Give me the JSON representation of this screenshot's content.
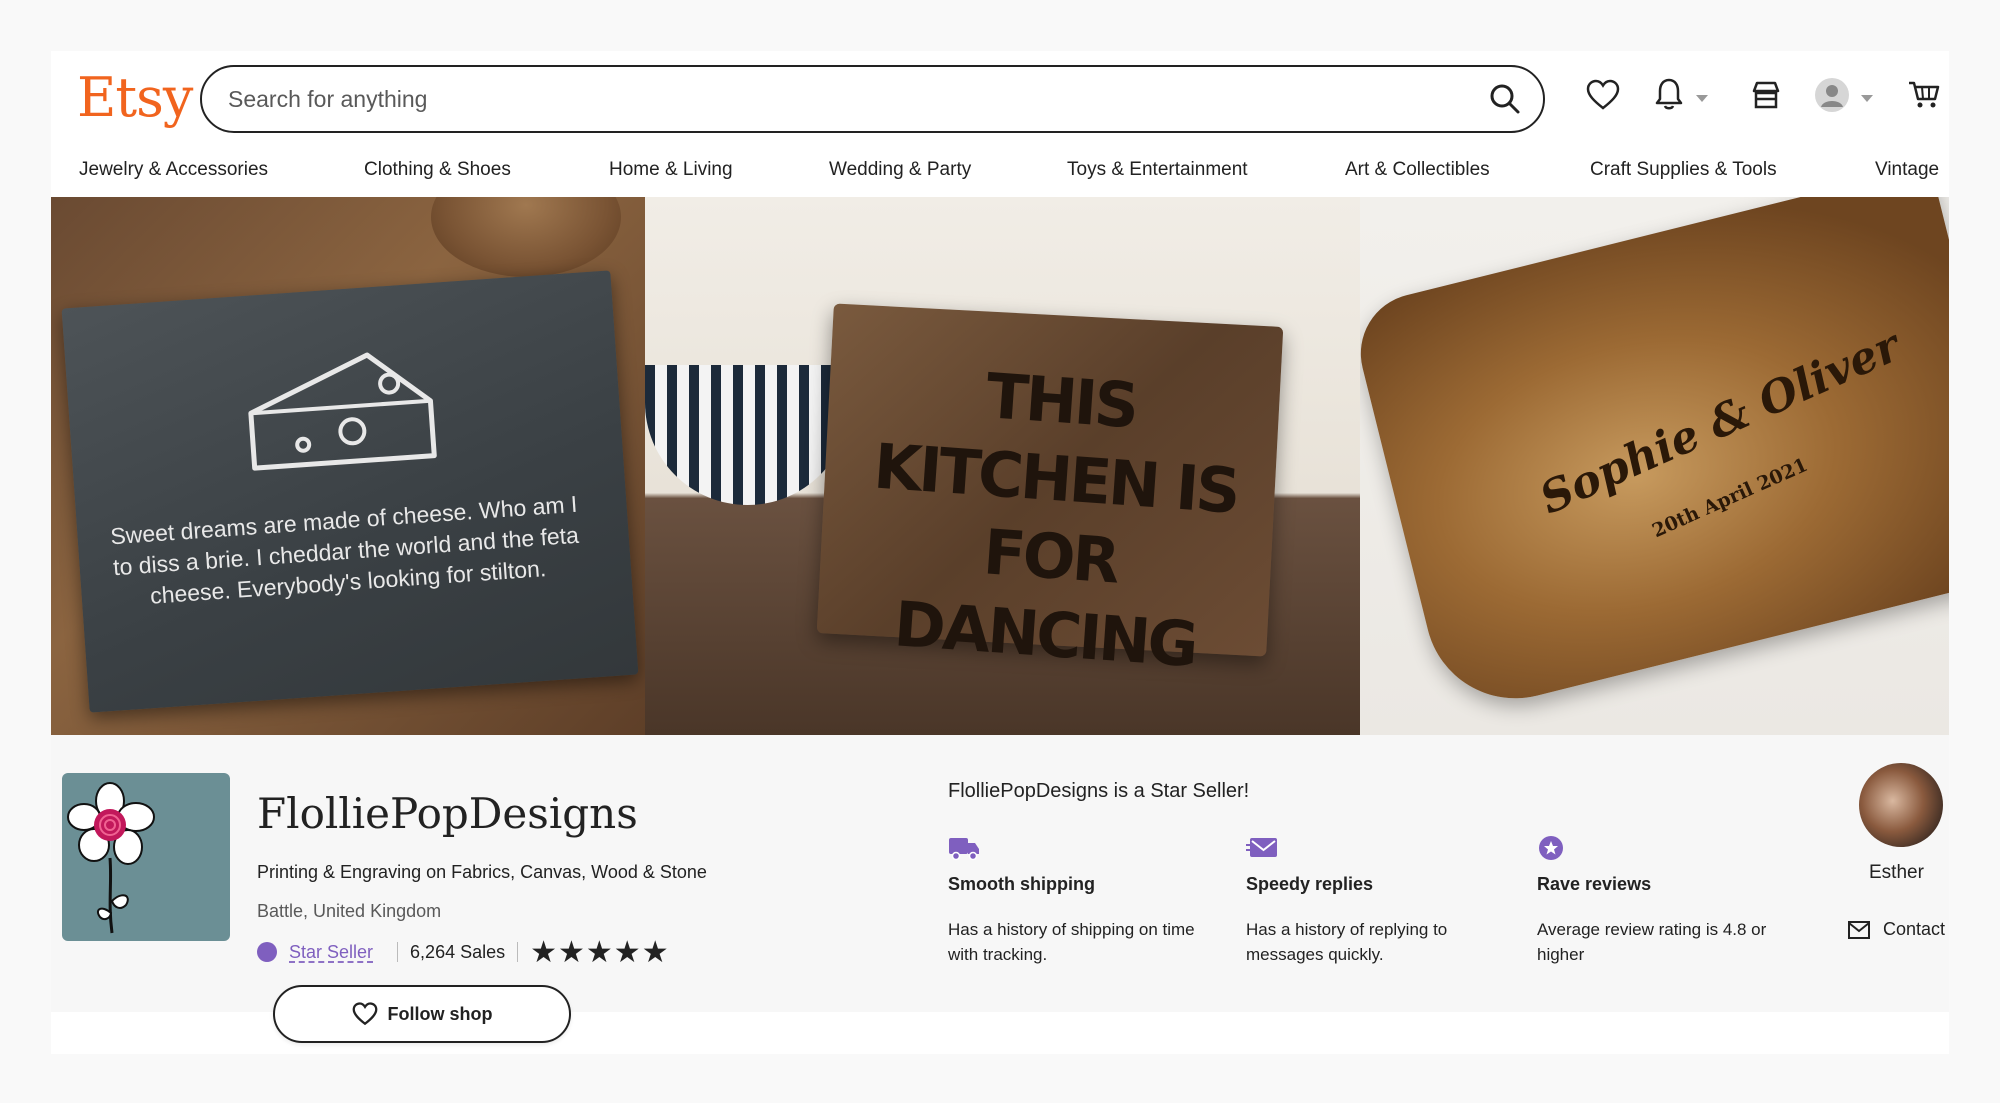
{
  "header": {
    "logo": "Etsy",
    "search_placeholder": "Search for anything"
  },
  "nav": {
    "items": [
      "Jewelry & Accessories",
      "Clothing & Shoes",
      "Home & Living",
      "Wedding & Party",
      "Toys & Entertainment",
      "Art & Collectibles",
      "Craft Supplies & Tools",
      "Vintage"
    ]
  },
  "banner": {
    "panel1_text": "Sweet dreams are made of cheese. Who am I to diss a brie. I cheddar the world and the feta cheese. Everybody's looking for stilton.",
    "panel2_text": "THIS KITCHEN IS FOR DANCING",
    "panel3_text": "Sophie & Oliver",
    "panel3_date": "20th April 2021"
  },
  "shop": {
    "name": "FlolliePopDesigns",
    "title": "Printing & Engraving on Fabrics, Canvas, Wood & Stone",
    "location": "Battle, United Kingdom",
    "star_seller_label": "Star Seller",
    "sales": "6,264 Sales",
    "rating_stars": "★★★★★",
    "follow_label": "Follow shop"
  },
  "star_seller": {
    "heading": "FlolliePopDesigns is a Star Seller!",
    "features": [
      {
        "title": "Smooth shipping",
        "desc": "Has a history of shipping on time with tracking.",
        "icon": "truck-icon"
      },
      {
        "title": "Speedy replies",
        "desc": "Has a history of replying to messages quickly.",
        "icon": "fast-message-icon"
      },
      {
        "title": "Rave reviews",
        "desc": "Average review rating is 4.8 or higher",
        "icon": "star-badge-icon"
      }
    ]
  },
  "owner": {
    "name": "Esther",
    "contact_label": "Contact"
  },
  "colors": {
    "brand": "#f1641e",
    "star_seller": "#7f5fbf"
  }
}
